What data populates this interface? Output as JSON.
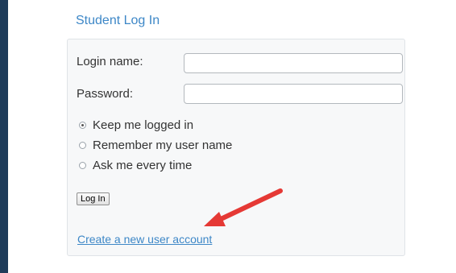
{
  "header": {
    "title": "Student Log In"
  },
  "form": {
    "login_label": "Login name:",
    "login_value": "",
    "password_label": "Password:",
    "password_value": "",
    "options": [
      {
        "label": "Keep me logged in",
        "selected": true
      },
      {
        "label": "Remember my user name",
        "selected": false
      },
      {
        "label": "Ask me every time",
        "selected": false
      }
    ],
    "login_button": "Log In",
    "create_account_link": "Create a new user account"
  },
  "annotation": {
    "arrow_color": "#e53935"
  }
}
